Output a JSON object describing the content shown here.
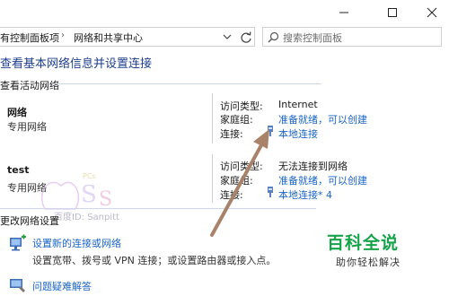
{
  "address": {
    "crumbs": [
      "有控制面板项",
      "网络和共享中心"
    ],
    "search_placeholder": "搜索控制面板"
  },
  "page_title": "查看基本网络信息并设置连接",
  "active_networks_header": "查看活动网络",
  "networks": [
    {
      "name": "网络",
      "type": "专用网络",
      "access_type_label": "访问类型:",
      "access_type_value": "Internet",
      "homegroup_label": "家庭组:",
      "homegroup_value": "准备就绪，可以创建",
      "connection_label": "连接:",
      "connection_value": "本地连接"
    },
    {
      "name": "test",
      "type": "专用网络",
      "access_type_label": "访问类型:",
      "access_type_value": "无法连接到网络",
      "homegroup_label": "家庭组:",
      "homegroup_value": "准备就绪，可以创建",
      "connection_label": "连接:",
      "connection_value": "本地连接* 4"
    }
  ],
  "change_settings_header": "更改网络设置",
  "tasks": [
    {
      "title": "设置新的连接或网络",
      "desc": "设置宽带、拨号或 VPN 连接；或设置路由器或接入点。"
    },
    {
      "title": "问题疑难解答",
      "desc": ""
    }
  ],
  "watermark_text": "百度ID: Sanpitt",
  "brand": {
    "title": "百科全说",
    "subtitle": "助你轻松解决"
  },
  "colors": {
    "link": "#1a66c6",
    "title": "#1e3f8c",
    "arrow": "#a9826a",
    "brand": "#16a34a"
  }
}
